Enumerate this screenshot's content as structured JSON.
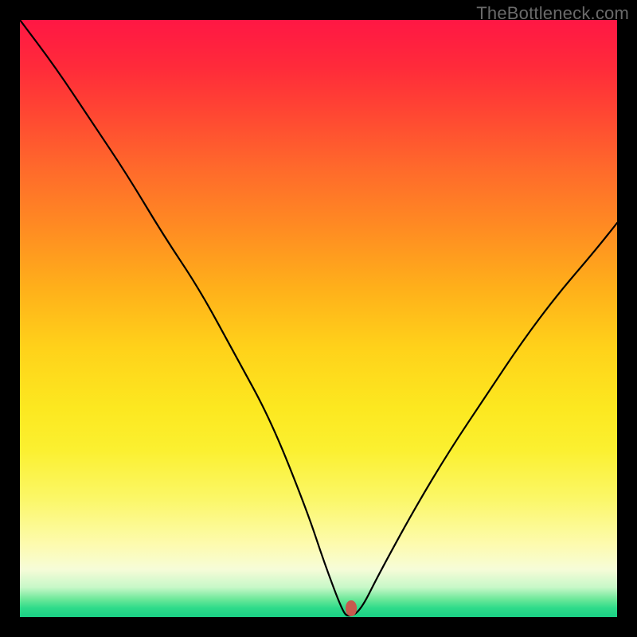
{
  "watermark": "TheBottleneck.com",
  "chart_data": {
    "type": "line",
    "title": "",
    "xlabel": "",
    "ylabel": "",
    "xlim": [
      0,
      100
    ],
    "ylim": [
      0,
      100
    ],
    "grid": false,
    "comment": "Values are read in chart-area coordinates where x is 0→100 left→right and y is 0 at bottom, 100 at top (bottleneck percentage). The curve shows a V shape reaching ~0 near x≈55.",
    "series": [
      {
        "name": "bottleneck-curve",
        "x": [
          0,
          6,
          12,
          18,
          24,
          30,
          36,
          42,
          48,
          51,
          54,
          55,
          57,
          60,
          66,
          72,
          78,
          84,
          90,
          96,
          100
        ],
        "y": [
          100,
          92,
          83,
          74,
          64,
          55,
          44,
          33,
          18,
          9,
          1,
          0,
          1,
          7,
          18,
          28,
          37,
          46,
          54,
          61,
          66
        ]
      }
    ],
    "marker": {
      "x": 55.5,
      "y": 1.5,
      "color": "#c75a4e"
    },
    "gradient_stops": [
      {
        "pct": 0,
        "color": "#ff1744"
      },
      {
        "pct": 15,
        "color": "#ff4433"
      },
      {
        "pct": 35,
        "color": "#ff8c22"
      },
      {
        "pct": 55,
        "color": "#ffd21a"
      },
      {
        "pct": 72,
        "color": "#fbf030"
      },
      {
        "pct": 88,
        "color": "#fdfbb0"
      },
      {
        "pct": 95,
        "color": "#c8f8c8"
      },
      {
        "pct": 100,
        "color": "#1ad085"
      }
    ]
  }
}
